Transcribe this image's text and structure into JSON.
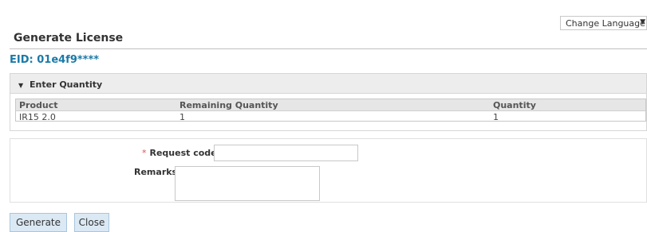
{
  "language": {
    "label": "Change Language"
  },
  "page": {
    "title": "Generate License",
    "eid": "EID: 01e4f9****"
  },
  "quantity_panel": {
    "title": "Enter Quantity",
    "columns": [
      "Product",
      "Remaining Quantity",
      "Quantity"
    ],
    "rows": [
      {
        "product": "IR15 2.0",
        "remaining": "1",
        "quantity": "1"
      }
    ]
  },
  "form": {
    "request_code_label": "Request code:",
    "request_code_value": "",
    "remarks_label": "Remarks:",
    "remarks_value": ""
  },
  "buttons": {
    "generate": "Generate",
    "close": "Close"
  }
}
